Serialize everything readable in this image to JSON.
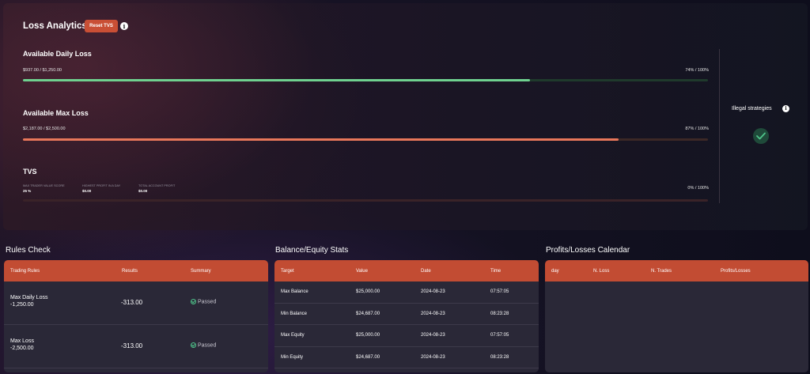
{
  "loss_analytics": {
    "title": "Loss Analytics",
    "reset_button": "Reset TVS",
    "info_icon": "i"
  },
  "daily_loss": {
    "label": "Available Daily Loss",
    "amount": "$937.00 / $1,250.00",
    "percent_text": "74% / 100%",
    "progress": 0.74,
    "color": "#6fd18f",
    "track_color": "#1f3a2c"
  },
  "max_loss": {
    "label": "Available Max Loss",
    "amount": "$2,187.00 / $2,500.00",
    "percent_text": "87% / 100%",
    "progress": 0.87,
    "color": "#e8775a",
    "track_color": "#3c2826"
  },
  "tvs": {
    "label": "TVS",
    "percent_text": "0% / 100%",
    "progress": 0,
    "track_color": "#3a2328",
    "metrics": [
      {
        "key": "MAX TRADER VALUE SCORE",
        "value": "25 %"
      },
      {
        "key": "HIGHEST PROFIT IN A DAY",
        "value": "$0.00"
      },
      {
        "key": "TOTAL ACCOUNT PROFIT",
        "value": "$0.00"
      }
    ]
  },
  "illegal_strategies": {
    "label": "Illegal strategies",
    "status_icon": "check-icon",
    "status_color": "#4fc38a"
  },
  "rules_check": {
    "title": "Rules Check",
    "headers": [
      "Trading Rules",
      "Results",
      "Summary"
    ],
    "rows": [
      {
        "rule": "Max Daily Loss",
        "limit": "-1,250.00",
        "result": "-313.00",
        "summary": "Passed"
      },
      {
        "rule": "Max Loss",
        "limit": "-2,500.00",
        "result": "-313.00",
        "summary": "Passed"
      }
    ]
  },
  "balance_stats": {
    "title": "Balance/Equity Stats",
    "headers": [
      "Target",
      "Value",
      "Date",
      "Time"
    ],
    "rows": [
      {
        "target": "Max Balance",
        "value": "$25,000.00",
        "date": "2024-08-23",
        "time": "07:57:05"
      },
      {
        "target": "Min Balance",
        "value": "$24,687.00",
        "date": "2024-08-23",
        "time": "08:23:28"
      },
      {
        "target": "Max Equity",
        "value": "$25,000.00",
        "date": "2024-08-23",
        "time": "07:57:05"
      },
      {
        "target": "Min Equity",
        "value": "$24,687.00",
        "date": "2024-08-23",
        "time": "08:23:28"
      }
    ]
  },
  "calendar": {
    "title": "Profits/Losses Calendar",
    "headers": [
      "day",
      "N. Loss",
      "N. Trades",
      "Profits/Losses"
    ]
  },
  "colors": {
    "accent": "#c24c33",
    "passed": "#4fc38a"
  }
}
